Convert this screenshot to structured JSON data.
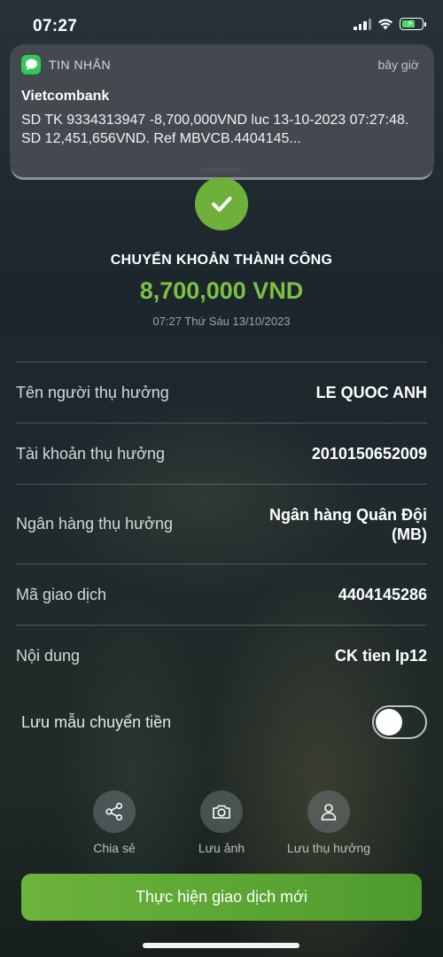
{
  "status_bar": {
    "time": "07:27"
  },
  "notification": {
    "app_name": "TIN NHẮN",
    "time": "bây giờ",
    "title": "Vietcombank",
    "body": "SD TK 9334313947 -8,700,000VND luc 13-10-2023 07:27:48. SD 12,451,656VND. Ref MBVCB.4404145..."
  },
  "result": {
    "title": "CHUYỂN KHOẢN THÀNH CÔNG",
    "amount": "8,700,000 VND",
    "datetime": "07:27 Thứ Sáu 13/10/2023"
  },
  "details": [
    {
      "label": "Tên người thụ hưởng",
      "value": "LE QUOC ANH"
    },
    {
      "label": "Tài khoản thụ hưởng",
      "value": "2010150652009"
    },
    {
      "label": "Ngân hàng thụ hưởng",
      "value": "Ngân hàng Quân Đội (MB)"
    },
    {
      "label": "Mã giao dịch",
      "value": "4404145286"
    },
    {
      "label": "Nội dung",
      "value": "CK tien Ip12"
    }
  ],
  "save_template": {
    "label": "Lưu mẫu chuyển tiền",
    "enabled": false
  },
  "actions": [
    {
      "label": "Chia sẻ",
      "icon": "share-icon"
    },
    {
      "label": "Lưu ảnh",
      "icon": "camera-icon"
    },
    {
      "label": "Lưu thụ hưởng",
      "icon": "user-icon"
    }
  ],
  "primary_button": {
    "label": "Thực hiện giao dịch mới"
  },
  "colors": {
    "accent": "#7cc242",
    "button": "#5ea835",
    "messages": "#34c759"
  }
}
